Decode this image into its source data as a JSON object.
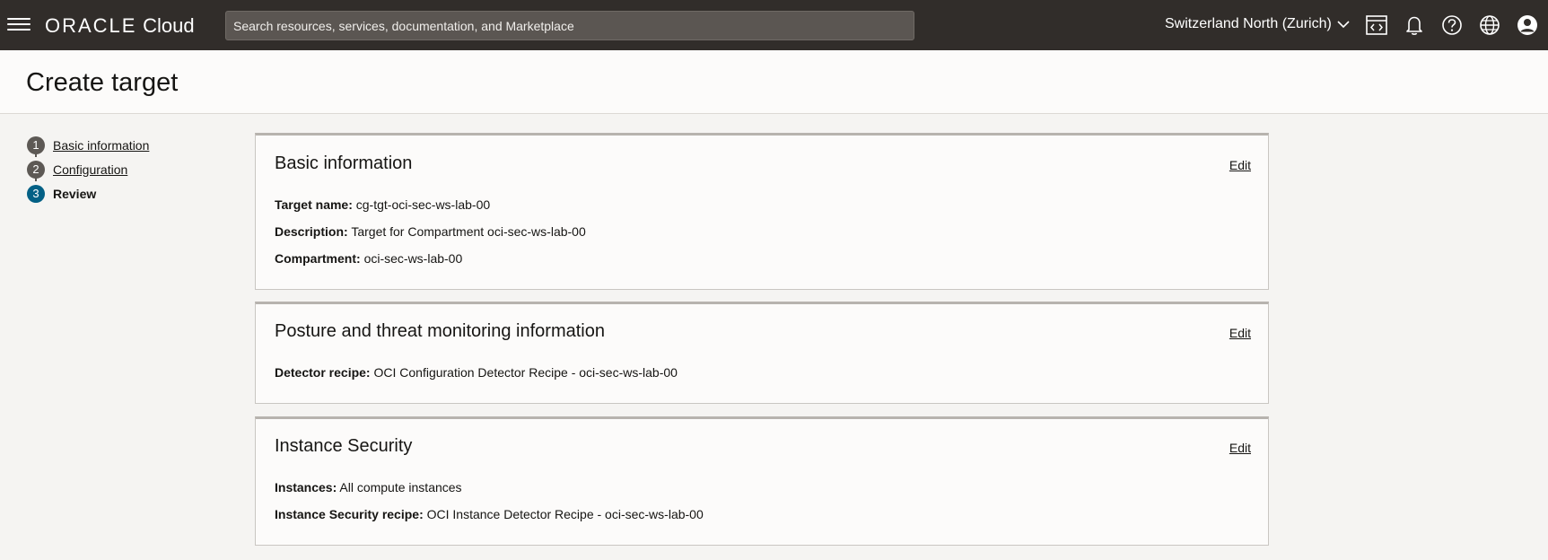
{
  "topbar": {
    "brand_oracle": "ORACLE",
    "brand_cloud": "Cloud",
    "search_placeholder": "Search resources, services, documentation, and Marketplace",
    "region": "Switzerland North (Zurich)",
    "icons": [
      "menu-icon",
      "cloud-shell-icon",
      "bell-icon",
      "help-icon",
      "globe-icon",
      "user-icon"
    ]
  },
  "page": {
    "title": "Create target"
  },
  "steps": [
    {
      "num": "1",
      "label": "Basic information"
    },
    {
      "num": "2",
      "label": "Configuration"
    },
    {
      "num": "3",
      "label": "Review"
    }
  ],
  "cards": {
    "basic": {
      "title": "Basic information",
      "edit": "Edit",
      "fields": [
        {
          "label": "Target name:",
          "value": "cg-tgt-oci-sec-ws-lab-00"
        },
        {
          "label": "Description:",
          "value": "Target for Compartment oci-sec-ws-lab-00"
        },
        {
          "label": "Compartment:",
          "value": "oci-sec-ws-lab-00"
        }
      ]
    },
    "posture": {
      "title": "Posture and threat monitoring information",
      "edit": "Edit",
      "fields": [
        {
          "label": "Detector recipe:",
          "value": "OCI Configuration Detector Recipe - oci-sec-ws-lab-00"
        }
      ]
    },
    "instance": {
      "title": "Instance Security",
      "edit": "Edit",
      "fields": [
        {
          "label": "Instances:",
          "value": "All compute instances"
        },
        {
          "label": "Instance Security recipe:",
          "value": "OCI Instance Detector Recipe - oci-sec-ws-lab-00"
        }
      ]
    }
  },
  "colors": {
    "topbar_bg": "#312d2a",
    "active_step": "#036085",
    "page_bg": "#f5f4f2"
  }
}
